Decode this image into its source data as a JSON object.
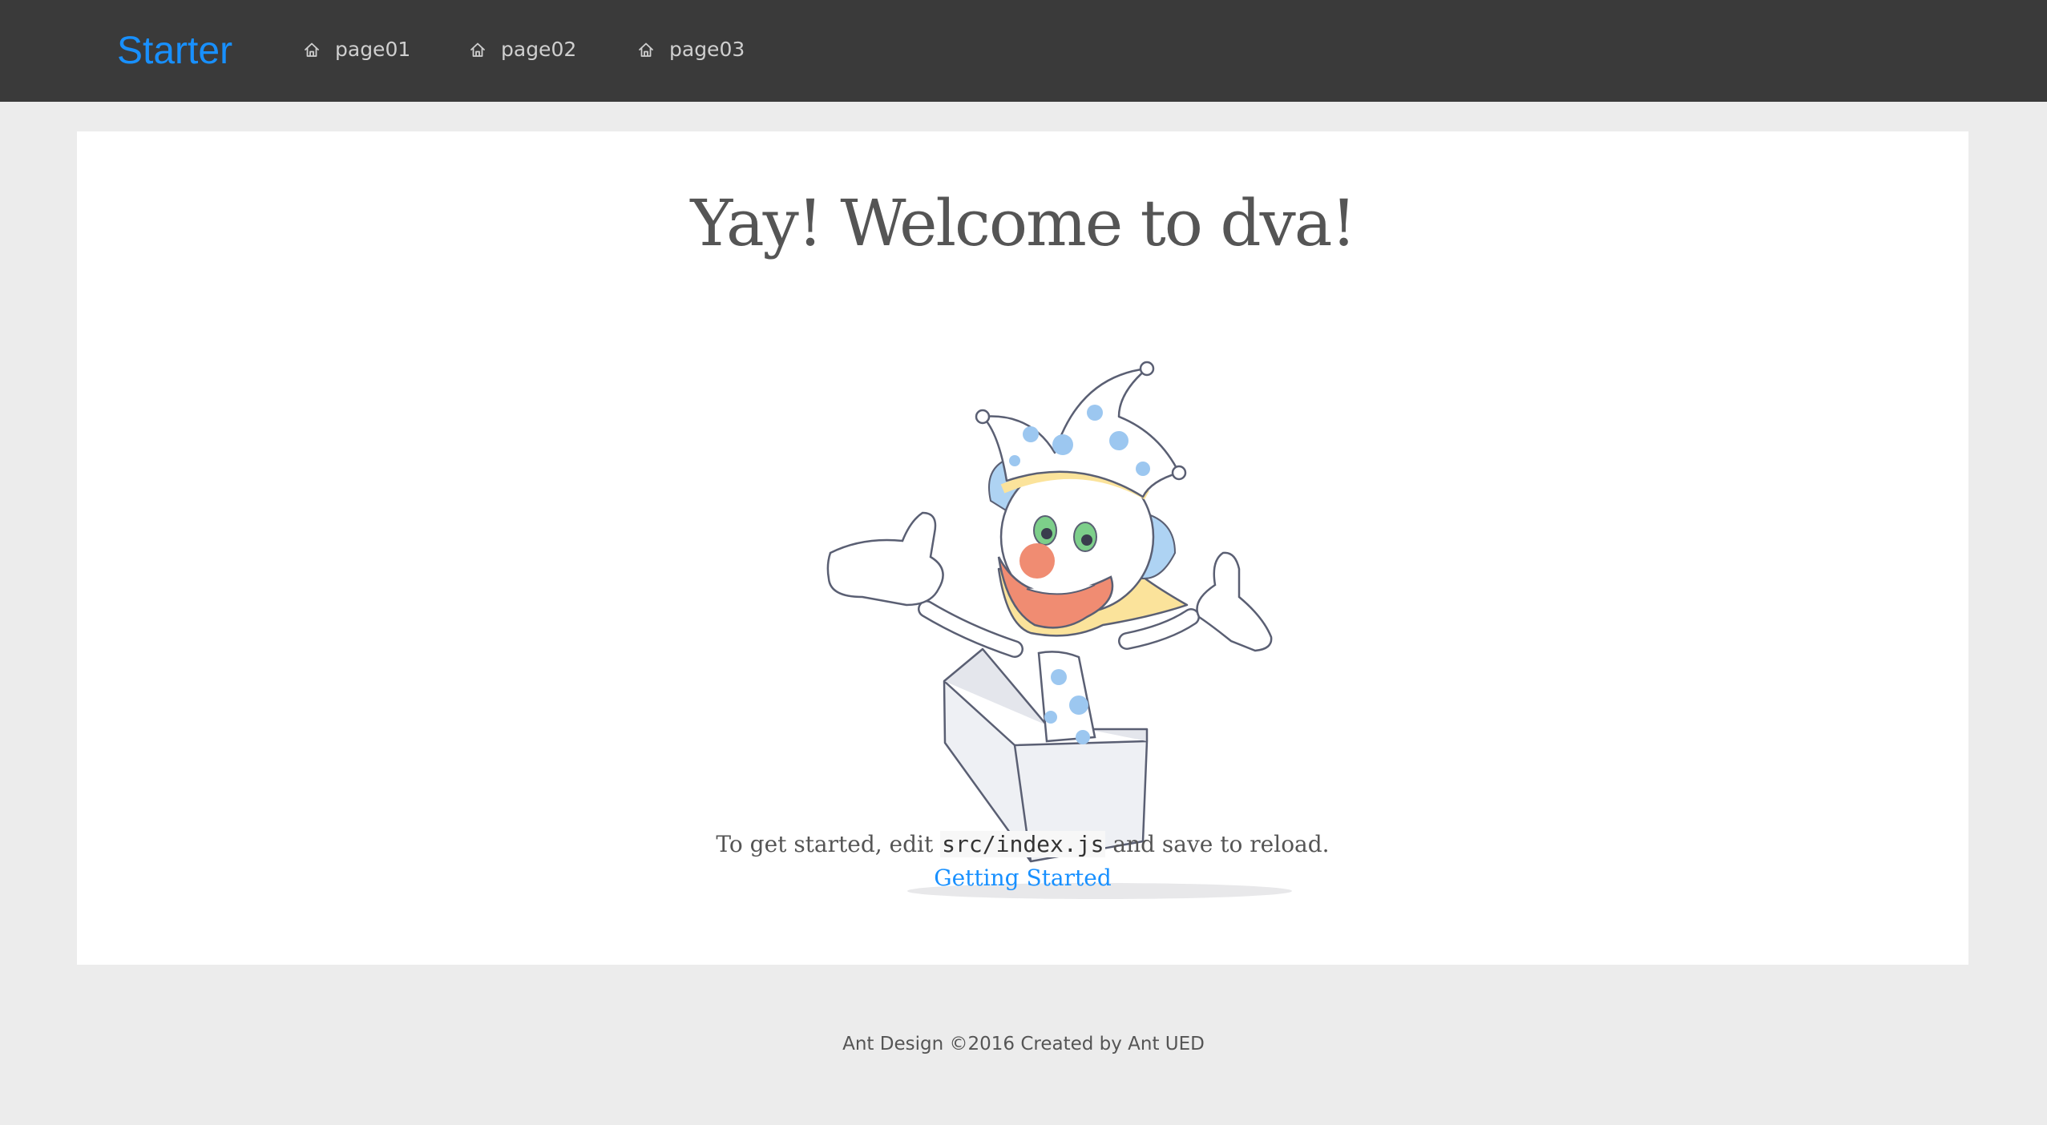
{
  "header": {
    "logo": "Starter",
    "nav": [
      {
        "label": "page01",
        "icon": "home-icon"
      },
      {
        "label": "page02",
        "icon": "home-icon"
      },
      {
        "label": "page03",
        "icon": "home-icon"
      }
    ]
  },
  "main": {
    "title": "Yay! Welcome to dva!",
    "illustration": "clown-illustration",
    "description_prefix": "To get started, edit",
    "description_code": "src/index.js",
    "description_suffix": "and save to reload.",
    "link_label": "Getting Started"
  },
  "footer": {
    "text": "Ant Design ©2016 Created by Ant UED"
  },
  "colors": {
    "header_bg": "#3a3a3a",
    "brand": "#1890ff",
    "page_bg": "#ececec",
    "card_bg": "#ffffff"
  }
}
